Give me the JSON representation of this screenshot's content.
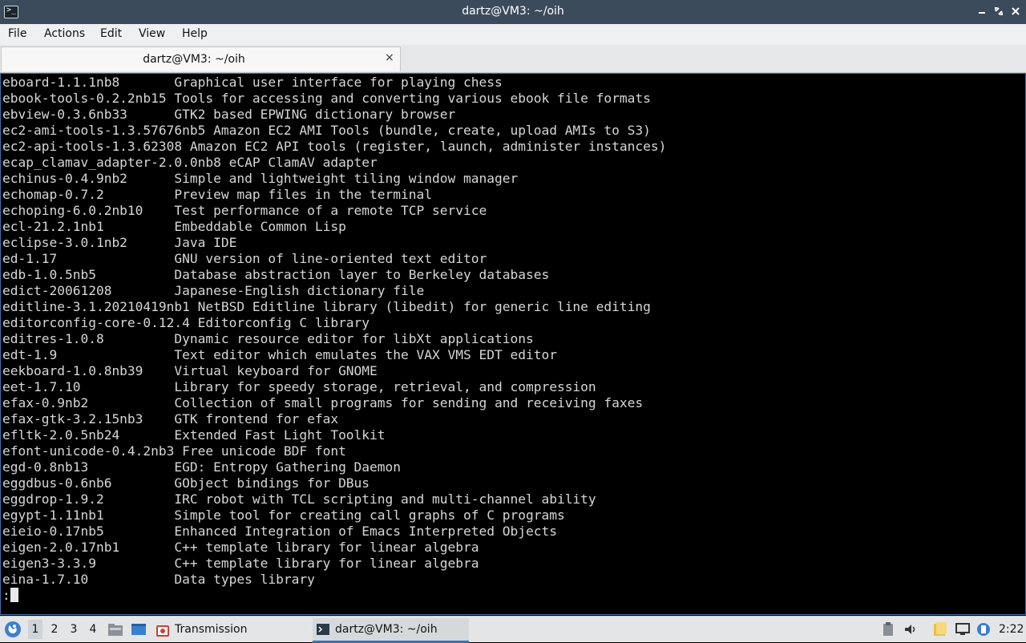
{
  "window": {
    "title": "dartz@VM3: ~/oih",
    "app_icon_glyph": ">_",
    "controls": [
      "minimize-icon",
      "maximize-icon",
      "close-icon"
    ]
  },
  "menu": [
    "File",
    "Actions",
    "Edit",
    "View",
    "Help"
  ],
  "tab": {
    "label": "dartz@VM3: ~/oih",
    "close_glyph": "×"
  },
  "terminal": {
    "lines": [
      "eboard-1.1.1nb8       Graphical user interface for playing chess",
      "ebook-tools-0.2.2nb15 Tools for accessing and converting various ebook file formats",
      "ebview-0.3.6nb33      GTK2 based EPWING dictionary browser",
      "ec2-ami-tools-1.3.57676nb5 Amazon EC2 AMI Tools (bundle, create, upload AMIs to S3)",
      "ec2-api-tools-1.3.62308 Amazon EC2 API tools (register, launch, administer instances)",
      "ecap_clamav_adapter-2.0.0nb8 eCAP ClamAV adapter",
      "echinus-0.4.9nb2      Simple and lightweight tiling window manager",
      "echomap-0.7.2         Preview map files in the terminal",
      "echoping-6.0.2nb10    Test performance of a remote TCP service",
      "ecl-21.2.1nb1         Embeddable Common Lisp",
      "eclipse-3.0.1nb2      Java IDE",
      "ed-1.17               GNU version of line-oriented text editor",
      "edb-1.0.5nb5          Database abstraction layer to Berkeley databases",
      "edict-20061208        Japanese-English dictionary file",
      "editline-3.1.20210419nb1 NetBSD Editline library (libedit) for generic line editing",
      "editorconfig-core-0.12.4 Editorconfig C library",
      "editres-1.0.8         Dynamic resource editor for libXt applications",
      "edt-1.9               Text editor which emulates the VAX VMS EDT editor",
      "eekboard-1.0.8nb39    Virtual keyboard for GNOME",
      "eet-1.7.10            Library for speedy storage, retrieval, and compression",
      "efax-0.9nb2           Collection of small programs for sending and receiving faxes",
      "efax-gtk-3.2.15nb3    GTK frontend for efax",
      "efltk-2.0.5nb24       Extended Fast Light Toolkit",
      "efont-unicode-0.4.2nb3 Free unicode BDF font",
      "egd-0.8nb13           EGD: Entropy Gathering Daemon",
      "eggdbus-0.6nb6        GObject bindings for DBus",
      "eggdrop-1.9.2         IRC robot with TCL scripting and multi-channel ability",
      "egypt-1.11nb1         Simple tool for creating call graphs of C programs",
      "eieio-0.17nb5         Enhanced Integration of Emacs Interpreted Objects",
      "eigen-2.0.17nb1       C++ template library for linear algebra",
      "eigen3-3.3.9          C++ template library for linear algebra",
      "eina-1.7.10           Data types library"
    ],
    "prompt": ":"
  },
  "taskbar": {
    "start_icon": "start-menu-icon",
    "workspaces": [
      "1",
      "2",
      "3",
      "4"
    ],
    "active_workspace": "1",
    "tasks": [
      {
        "label": "Transmission",
        "icon": "transmission-icon"
      },
      {
        "label": "dartz@VM3: ~/oih",
        "icon": "terminal-icon"
      }
    ],
    "tray_icons": [
      "clipboard-icon",
      "volume-icon",
      "files-icon",
      "network-icon",
      "battery-icon"
    ],
    "clock": "2:22"
  },
  "colors": {
    "titlebar": "#3c4b5c",
    "terminal_bg": "#000000",
    "terminal_fg": "#d6d6d6",
    "accent": "#3d6fb0"
  }
}
